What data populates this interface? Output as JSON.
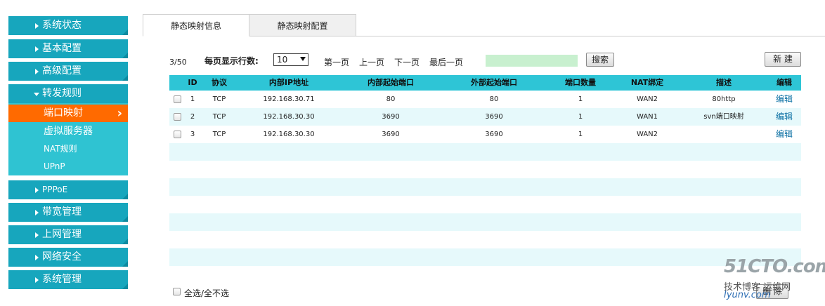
{
  "sidebar": {
    "items": [
      {
        "label": "系统状态"
      },
      {
        "label": "基本配置"
      },
      {
        "label": "高级配置"
      },
      {
        "label": "转发规则"
      },
      {
        "label": "PPPoE"
      },
      {
        "label": "带宽管理"
      },
      {
        "label": "上网管理"
      },
      {
        "label": "网络安全"
      },
      {
        "label": "系统管理"
      }
    ],
    "sub_items": [
      {
        "label": "端口映射",
        "active": true
      },
      {
        "label": "虚拟服务器"
      },
      {
        "label": "NAT规则"
      },
      {
        "label": "UPnP"
      }
    ]
  },
  "tabs": [
    {
      "label": "静态映射信息",
      "active": true
    },
    {
      "label": "静态映射配置"
    }
  ],
  "toolbar": {
    "page_count": "3/50",
    "rows_label": "每页显示行数:",
    "rows_value": "10",
    "first_page": "第一页",
    "prev_page": "上一页",
    "next_page": "下一页",
    "last_page": "最后一页",
    "search_value": "",
    "search_button": "搜索",
    "new_button": "新 建"
  },
  "table": {
    "columns": [
      "ID",
      "协议",
      "内部IP地址",
      "内部起始端口",
      "外部起始端口",
      "端口数量",
      "NAT绑定",
      "描述",
      "编辑"
    ],
    "rows": [
      {
        "id": "1",
        "protocol": "TCP",
        "ip": "192.168.30.71",
        "in_port": "80",
        "out_port": "80",
        "count": "1",
        "nat": "WAN2",
        "desc": "80http",
        "edit": "编辑"
      },
      {
        "id": "2",
        "protocol": "TCP",
        "ip": "192.168.30.30",
        "in_port": "3690",
        "out_port": "3690",
        "count": "1",
        "nat": "WAN1",
        "desc": "svn端口映射",
        "edit": "编辑"
      },
      {
        "id": "3",
        "protocol": "TCP",
        "ip": "192.168.30.30",
        "in_port": "3690",
        "out_port": "3690",
        "count": "1",
        "nat": "WAN2",
        "desc": "",
        "edit": "编辑"
      }
    ]
  },
  "footer": {
    "select_all": "全选/全不选",
    "delete_button": "删 除"
  },
  "watermark": {
    "line1": "51CTO.com",
    "line2": "技术博客 运维网",
    "line3": "Iyunv.com"
  },
  "colors": {
    "nav_bg": "#17a6bd",
    "sub_bg": "#2fc3d2",
    "active": "#ff6a00",
    "table_header": "#2ec5d6",
    "row_alt": "#e6f9fb"
  }
}
